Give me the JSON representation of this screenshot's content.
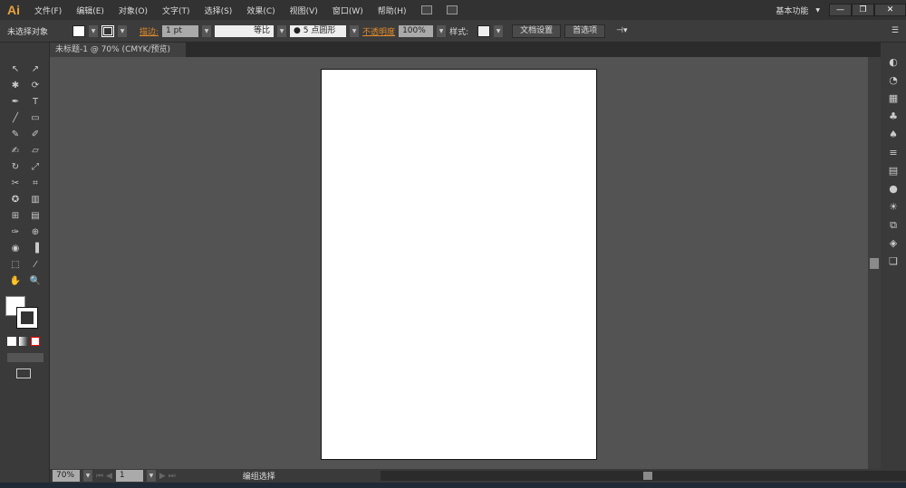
{
  "app": {
    "logo": "Ai",
    "workspace": "基本功能"
  },
  "menu": [
    "文件(F)",
    "编辑(E)",
    "对象(O)",
    "文字(T)",
    "选择(S)",
    "效果(C)",
    "视图(V)",
    "窗口(W)",
    "帮助(H)"
  ],
  "window_buttons": {
    "minimize": "—",
    "restore": "❐",
    "close": "✕"
  },
  "control": {
    "selection": "未选择对象",
    "stroke_label": "描边:",
    "stroke_weight": "1 pt",
    "stroke_profile": "等比",
    "brush": "● 5 点圆形",
    "opacity_label": "不透明度",
    "opacity": "100%",
    "style_label": "样式:",
    "doc_setup": "文档设置",
    "preferences": "首选项"
  },
  "tab": {
    "title": "未标题-1 @ 70% (CMYK/预览)",
    "close": "×"
  },
  "status": {
    "zoom": "70%",
    "page": "1",
    "tool": "编组选择"
  },
  "tools": [
    "↖",
    "↗",
    "✱",
    "⟳",
    "✒",
    "T",
    "╱",
    "▭",
    "✎",
    "✐",
    "✍",
    "▱",
    "↻",
    "⤢",
    "✂",
    "⌗",
    "✪",
    "▥",
    "⊞",
    "▤",
    "✑",
    "⊕",
    "◉",
    "▐",
    "⬚",
    "⁄",
    "✋",
    "🔍"
  ],
  "right_icons": [
    "◐",
    "◔",
    "▦",
    "♣",
    "♠",
    "≡",
    "▤",
    "●",
    "☀",
    "⧉",
    "◈",
    "❏"
  ]
}
